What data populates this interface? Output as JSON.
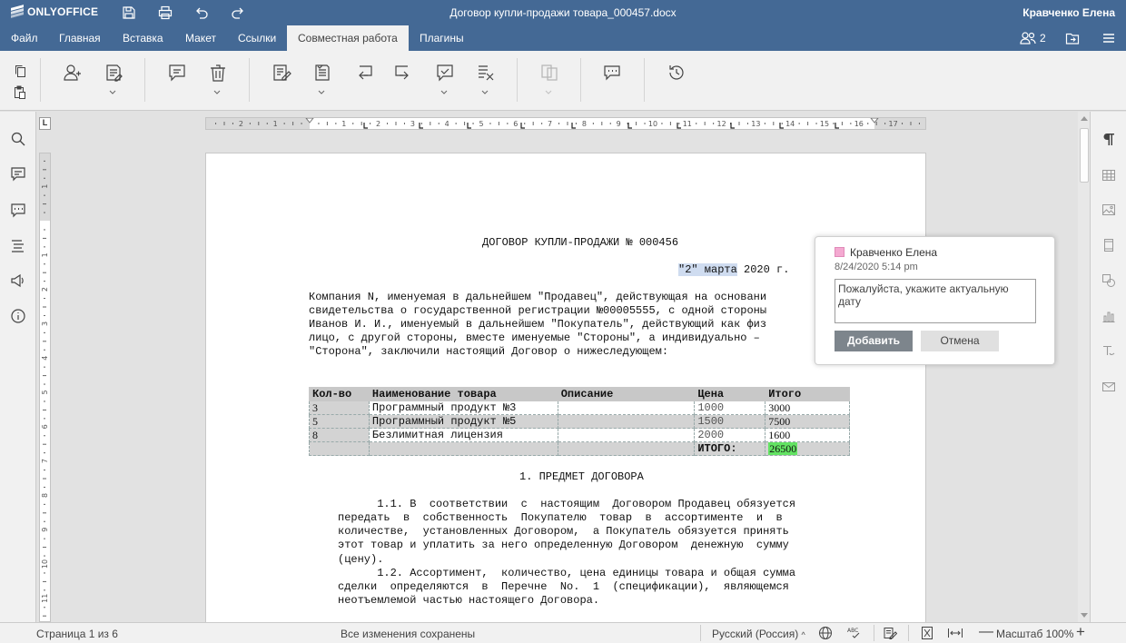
{
  "app": {
    "logo_text": "ONLYOFFICE",
    "document_title": "Договор купли-продажи товара_000457.docx",
    "user_name": "Кравченко Елена"
  },
  "menu": {
    "tabs": [
      "Файл",
      "Главная",
      "Вставка",
      "Макет",
      "Ссылки",
      "Совместная работа",
      "Плагины"
    ],
    "active_tab": "Совместная работа",
    "users_count": "2"
  },
  "document": {
    "title_line": "ДОГОВОР КУПЛИ-ПРОДАЖИ № 000456",
    "date_selected": "\"2\" марта",
    "date_rest": " 2020 г.",
    "intro": [
      "Компания N, именуемая в дальнейшем \"Продавец\", действующая на основани",
      "свидетельства о государственной регистрации №00005555, с одной стороны",
      "Иванов И. И., именуемый в дальнейшем \"Покупатель\", действующий как физ",
      "лицо, с другой стороны, вместе именуемые \"Стороны\", а индивидуально –",
      "\"Сторона\", заключили настоящий Договор о нижеследующем:"
    ],
    "table": {
      "headers": [
        "Кол-во",
        "Наименование товара",
        "Описание",
        "Цена",
        "Итого"
      ],
      "rows": [
        {
          "qty": "3",
          "name": "Программный продукт №3",
          "desc": "",
          "price": "1000",
          "total": "3000"
        },
        {
          "qty": "5",
          "name": "Программный продукт №5",
          "desc": "",
          "price": "1500",
          "total": "7500"
        },
        {
          "qty": "8",
          "name": "Безлимитная лицензия",
          "desc": "",
          "price": "2000",
          "total": "1600"
        }
      ],
      "total_label": "ИТОГО:",
      "total_value": "26500"
    },
    "section_title": "1. ПРЕДМЕТ ДОГОВОРА",
    "body_lines": [
      "      1.1. В  соответствии  с  настоящим  Договором Продавец обязуется",
      "передать  в  собственность  Покупателю  товар  в  ассортименте  и  в",
      "количестве,  установленных Договором,  а Покупатель обязуется принять",
      "этот товар и уплатить за него определенную Договором  денежную  сумму",
      "(цену).",
      "      1.2. Ассортимент,  количество, цена единицы товара и общая сумма",
      "сделки  определяются  в  Перечне  No.  1  (спецификации),  являющемся",
      "неотъемлемой частью настоящего Договора."
    ]
  },
  "comment": {
    "author": "Кравченко Елена",
    "date": "8/24/2020 5:14 pm",
    "text": "Пожалуйста, укажите актуальную дату",
    "add_label": "Добавить",
    "cancel_label": "Отмена",
    "author_color": "#f4a9d1"
  },
  "ruler": {
    "h_numbers": [
      "2",
      "1",
      "1",
      "2",
      "3",
      "4",
      "5",
      "6",
      "7",
      "8",
      "9",
      "10",
      "11",
      "12",
      "13",
      "14",
      "15",
      "16",
      "17"
    ],
    "v_numbers": [
      "1",
      "1",
      "2",
      "3",
      "4",
      "5",
      "6",
      "7",
      "8",
      "9",
      "10",
      "11"
    ]
  },
  "status": {
    "page": "Страница 1 из 6",
    "saved": "Все изменения сохранены",
    "language": "Русский (Россия)",
    "zoom": "Масштаб 100%"
  },
  "colors": {
    "header_bg": "#446995",
    "toolbar_bg": "#f1f1f1",
    "highlight_green": "#63e363",
    "selection": "#cfdcf0"
  }
}
